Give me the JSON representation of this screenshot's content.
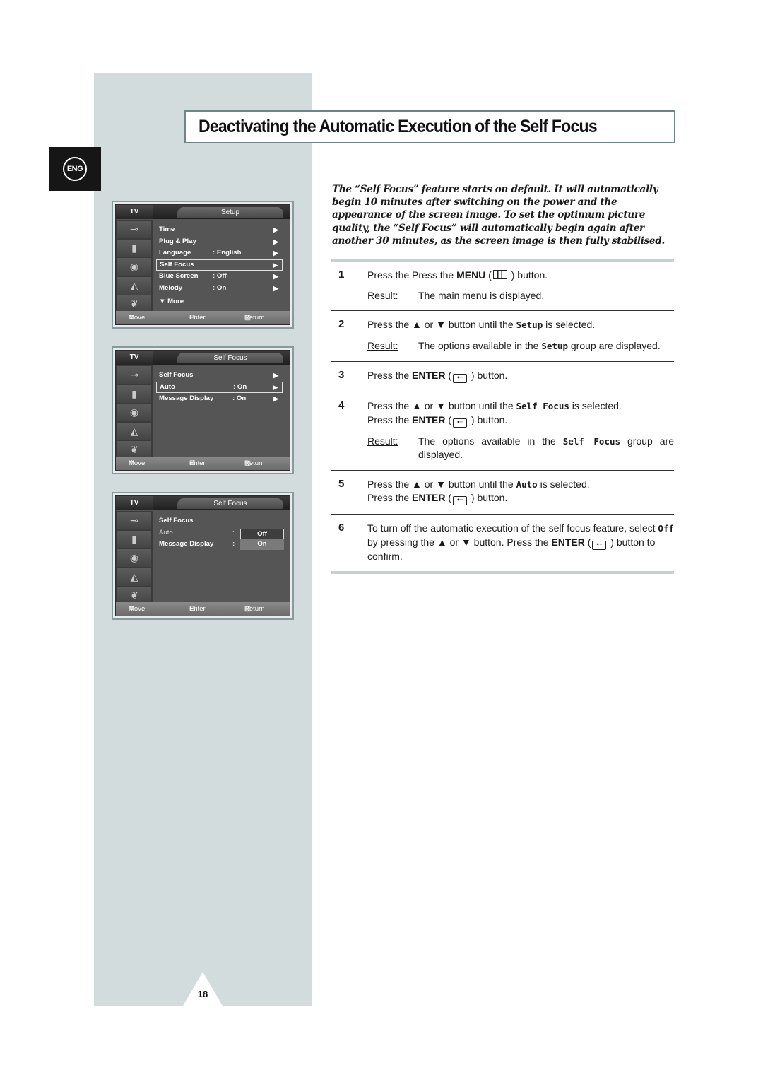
{
  "page": {
    "language_tab": "ENG",
    "title": "Deactivating the Automatic Execution of the Self Focus",
    "intro": "The “Self Focus” feature starts on default.  It will automatically begin 10 minutes after switching on the power and the appearance of the screen image. To set the optimum picture quality, the “Self Focus” will automatically begin again after another 30 minutes, as the screen image is then fully stabilised.",
    "page_number": "18"
  },
  "osd_common": {
    "tv_label": "TV",
    "footer": {
      "move": "Move",
      "enter": "Enter",
      "return": "Return"
    },
    "icons": [
      "antenna-icon",
      "picture-icon",
      "sound-icon",
      "channel-icon",
      "setup-icon"
    ]
  },
  "menus": [
    {
      "title": "Setup",
      "rows": [
        {
          "label": "Time",
          "value": "",
          "arrow": "▶"
        },
        {
          "label": "Plug & Play",
          "value": "",
          "arrow": "▶"
        },
        {
          "label": "Language",
          "value": ":  English",
          "arrow": "▶"
        },
        {
          "label": "Self Focus",
          "value": "",
          "arrow": "▶",
          "selected": true
        },
        {
          "label": "Blue Screen",
          "value": ":  Off",
          "arrow": "▶"
        },
        {
          "label": "Melody",
          "value": ":  On",
          "arrow": "▶"
        },
        {
          "label": "▼ More",
          "value": "",
          "arrow": ""
        }
      ]
    },
    {
      "title": "Self Focus",
      "rows": [
        {
          "label": "Self Focus",
          "value": "",
          "arrow": "▶"
        },
        {
          "label": "Auto",
          "value": ":  On",
          "arrow": "▶",
          "selected": true
        },
        {
          "label": "Message Display",
          "value": ":  On",
          "arrow": "▶"
        }
      ]
    },
    {
      "title": "Self Focus",
      "rows": [
        {
          "label": "Self Focus",
          "value": "",
          "arrow": ""
        },
        {
          "label": "Auto",
          "value": ":",
          "arrow": "",
          "dim": true
        },
        {
          "label": "Message Display",
          "value": ":",
          "arrow": ""
        }
      ],
      "popup": {
        "selected": "Off",
        "option": "On"
      }
    }
  ],
  "steps": [
    {
      "num": "1",
      "parts": [
        "Press the    Press the ",
        "MENU",
        " (",
        "",
        " ) button."
      ],
      "result_label": "Result:",
      "result": "The main menu is displayed."
    },
    {
      "num": "2",
      "text_a": "Press the ▲ or ▼ button until the ",
      "code": "Setup",
      "text_b": "  is selected.",
      "result_label": "Result:",
      "result_a": "The options available in the ",
      "result_code": "Setup",
      "result_b": " group are displayed."
    },
    {
      "num": "3",
      "text_a": "Press the ",
      "bold": "ENTER",
      "text_b": " (",
      "text_c": " ) button."
    },
    {
      "num": "4",
      "text_a": "Press the ▲ or ▼ button until the ",
      "code": "Self Focus",
      "text_b": " is selected.",
      "line2_a": "Press the ",
      "line2_bold": "ENTER",
      "line2_b": " (",
      "line2_c": " ) button.",
      "result_label": "Result:",
      "result_a": "The options available in the ",
      "result_code": "Self  Focus",
      "result_b": " group are displayed."
    },
    {
      "num": "5",
      "text_a": "Press the ▲ or ▼ button until the ",
      "code": "Auto",
      "text_b": " is selected.",
      "line2_a": "Press the ",
      "line2_bold": "ENTER",
      "line2_b": " (",
      "line2_c": " ) button."
    },
    {
      "num": "6",
      "text_a": "To turn off the automatic execution of the self focus feature, select ",
      "code": "Off",
      "text_b": " by pressing the ▲ or ▼ button. Press the ",
      "bold": "ENTER",
      "text_c": " (",
      "text_d": " ) button to confirm."
    }
  ]
}
